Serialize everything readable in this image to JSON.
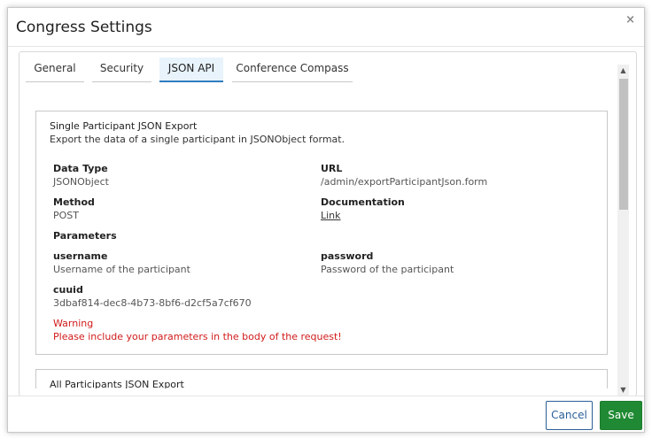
{
  "dialog": {
    "title": "Congress Settings",
    "close_glyph": "×",
    "tabs": [
      {
        "label": "General"
      },
      {
        "label": "Security"
      },
      {
        "label": "JSON API"
      },
      {
        "label": "Conference Compass"
      }
    ],
    "active_tab": "JSON API"
  },
  "cards": [
    {
      "title": "Single Participant JSON Export",
      "description": "Export the data of a single participant in JSONObject format.",
      "data_type_label": "Data Type",
      "data_type_value": "JSONObject",
      "url_label": "URL",
      "url_value": "/admin/exportParticipantJson.form",
      "method_label": "Method",
      "method_value": "POST",
      "documentation_label": "Documentation",
      "documentation_link": "Link",
      "parameters_label": "Parameters",
      "params": [
        {
          "name": "username",
          "desc": "Username of the participant"
        },
        {
          "name": "password",
          "desc": "Password of the participant"
        },
        {
          "name": "cuuid",
          "desc": "3dbaf814-dec8-4b73-8bf6-d2cf5a7cf670"
        }
      ],
      "warning_label": "Warning",
      "warning_text": "Please include your parameters in the body of the request!"
    },
    {
      "title": "All Participants JSON Export"
    }
  ],
  "footer": {
    "cancel_label": "Cancel",
    "save_label": "Save"
  },
  "colors": {
    "active_tab_underline": "#2f7ec1",
    "warning": "#d11a1a",
    "save_bg": "#1f8a33",
    "cancel_border": "#2a5f98"
  }
}
